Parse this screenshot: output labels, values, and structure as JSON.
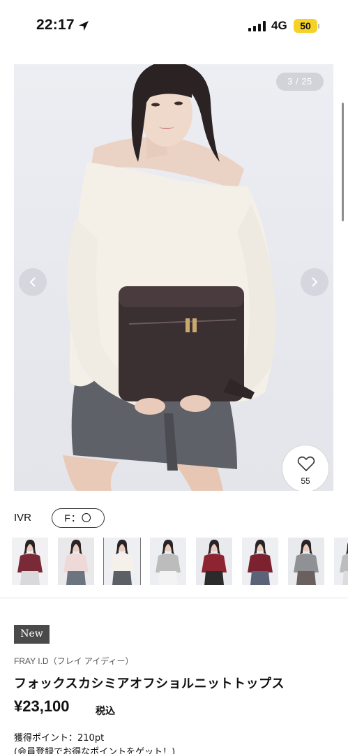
{
  "status_bar": {
    "time": "22:17",
    "network": "4G",
    "battery": "50",
    "colors": {
      "battery_fill": "#f6d226"
    }
  },
  "gallery": {
    "counter": "3 / 25",
    "prev_icon": "chevron-left-icon",
    "next_icon": "chevron-right-icon",
    "favorite_icon": "heart-icon",
    "favorite_count": "55"
  },
  "variant": {
    "code": "IVR",
    "size_chip": "F：〇"
  },
  "thumbnails": [
    {
      "label": "thumb-burgundy-knit",
      "sweater": "#7a2a36",
      "bottom": "#d9d9dc",
      "bg": "#f1f1f3"
    },
    {
      "label": "thumb-pink-knit",
      "sweater": "#efd8d8",
      "bottom": "#6c7480",
      "bg": "#e9e9ec"
    },
    {
      "label": "thumb-white-knit",
      "sweater": "#f5f1ea",
      "bottom": "#5d5f66",
      "bg": "#eeeff3",
      "active": true
    },
    {
      "label": "thumb-gray-knit",
      "sweater": "#bcbcbc",
      "bottom": "#f3f3f3",
      "bg": "#eceef1"
    },
    {
      "label": "thumb-red-knit-sitting",
      "sweater": "#8e2431",
      "bottom": "#2b2b2b",
      "bg": "#e9eaed"
    },
    {
      "label": "thumb-red-knit-jeans",
      "sweater": "#7b2130",
      "bottom": "#5b6378",
      "bg": "#eeeff2"
    },
    {
      "label": "thumb-gray-knit-skirt",
      "sweater": "#8f9194",
      "bottom": "#6a6060",
      "bg": "#e9eaed"
    },
    {
      "label": "thumb-partial",
      "sweater": "#bdbdbd",
      "bottom": "#dcdcdc",
      "bg": "#eceef1"
    }
  ],
  "product": {
    "badge": "New",
    "brand": "FRAY I.D（フレイ アイディー）",
    "title": "フォックスカシミアオフショルニットトップス",
    "price": "¥23,100",
    "tax_label": "税込",
    "points": "獲得ポイント：210pt",
    "points_note": "(会員登録でお得なポイントをゲット！)"
  }
}
